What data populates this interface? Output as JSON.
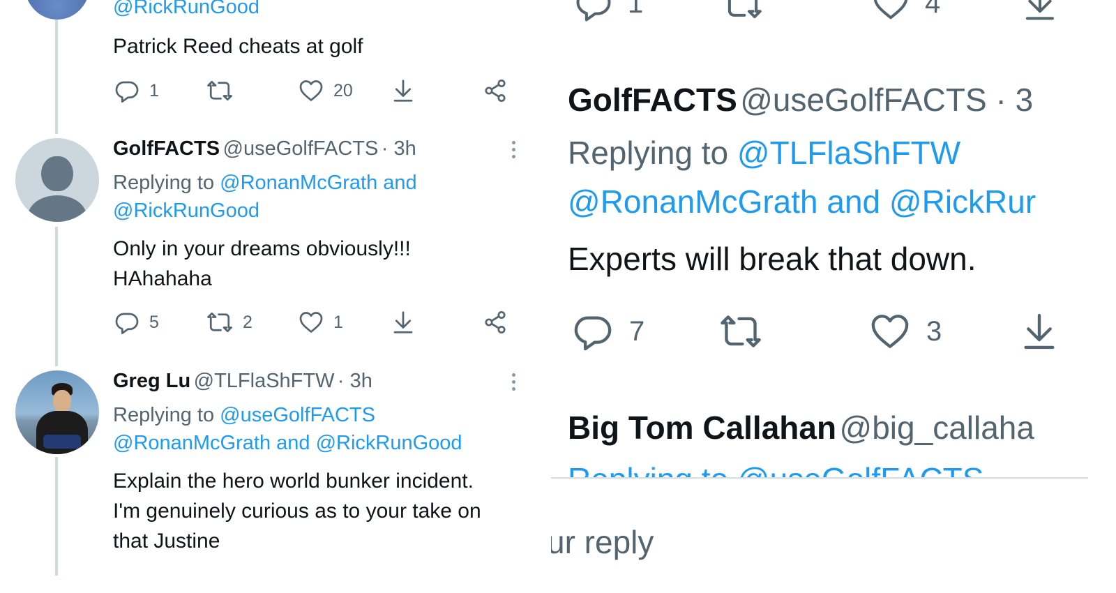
{
  "left": {
    "top_tweet": {
      "handle_partial": "@RickRunGood",
      "text": "Patrick Reed cheats at golf",
      "replies": "1",
      "retweets": "",
      "likes": "20"
    },
    "tweet2": {
      "name": "GolfFACTS",
      "handle": "@useGolfFACTS",
      "time": "· 3h",
      "replying_to_label": "Replying to",
      "reply_line1_link": "@RonanMcGrath and",
      "reply_line2_link": "@RickRunGood",
      "text_line1": "Only in your dreams obviously!!!",
      "text_line2": "HAhahaha",
      "replies": "5",
      "retweets": "2",
      "likes": "1"
    },
    "tweet3": {
      "name": "Greg Lu",
      "handle": "@TLFlaShFTW",
      "time": "· 3h",
      "replying_to_label": "Replying to",
      "reply_line1_link": "@useGolfFACTS",
      "reply_line2_link": "@RonanMcGrath and @RickRunGood",
      "text_line1": "Explain the hero world bunker incident.",
      "text_line2": "I'm genuinely curious as to your take on",
      "text_line3": "that Justine"
    }
  },
  "right": {
    "top_partial_counts": {
      "replies": "1",
      "likes": "4"
    },
    "tweet": {
      "name": "GolfFACTS",
      "handle": "@useGolfFACTS · 3",
      "replying_to_label": "Replying to",
      "reply_line1_link": "@TLFlaShFTW",
      "reply_line2_link": "@RonanMcGrath and @RickRur",
      "text": "Experts will break that down.",
      "replies": "7",
      "likes": "3"
    },
    "next_tweet": {
      "name": "Big Tom Callahan",
      "handle": "@big_callaha",
      "reply_partial": "Replying to @useGolfFACTS"
    },
    "reply_input_partial": "ur reply"
  },
  "colors": {
    "text": "#0f1419",
    "secondary": "#536471",
    "link": "#1d9bf0",
    "thread_line": "#cfd9de"
  },
  "icons": [
    "reply-icon",
    "retweet-icon",
    "like-icon",
    "download-icon",
    "share-icon",
    "more-options-icon"
  ]
}
